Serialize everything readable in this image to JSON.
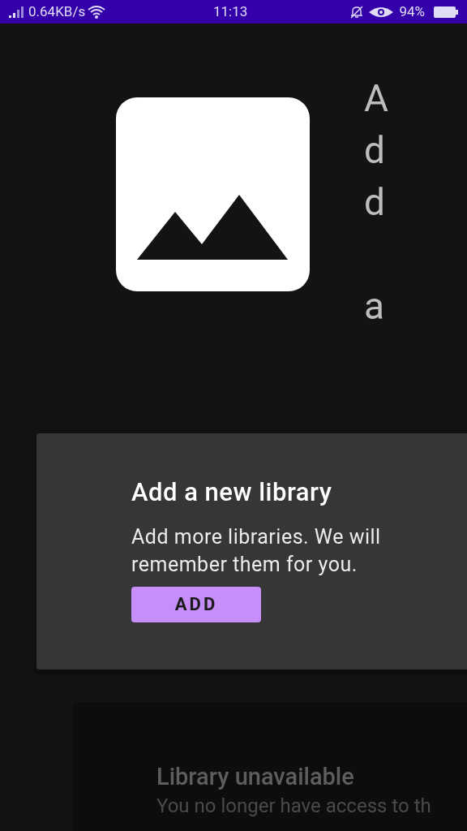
{
  "status_bar": {
    "speed": "0.64KB/s",
    "time": "11:13",
    "battery": "94%"
  },
  "header": {
    "vertical_title": "Add a"
  },
  "add_card": {
    "title": "Add a new library",
    "body": "Add more libraries. We will remember them for you.",
    "button": "ADD"
  },
  "unavailable_card": {
    "title": "Library unavailable",
    "body": "You no longer have access to th"
  }
}
